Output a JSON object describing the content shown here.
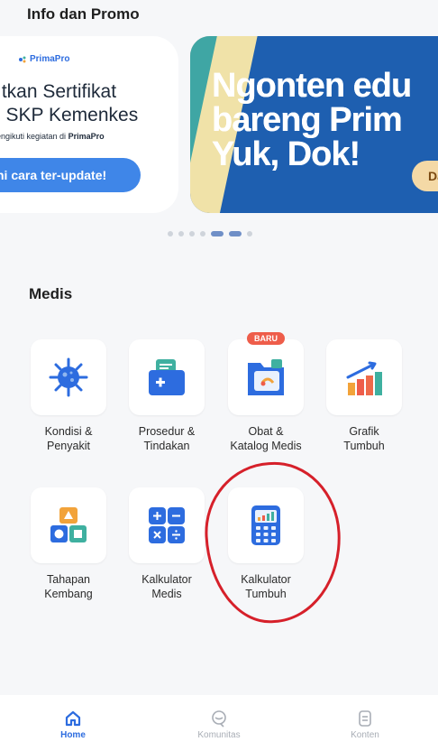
{
  "header": {
    "title": "Info dan Promo"
  },
  "carousel": {
    "card_left": {
      "brand": "PrimaPro",
      "line1": "ıtkan Sertifikat",
      "line2": "i SKP Kemenkes",
      "sub_prefix": "engikuti kegiatan di ",
      "sub_bold": "PrimaPro",
      "cta": "ni cara ter-update!"
    },
    "card_right": {
      "line1": "Ngonten edu",
      "line2": "bareng Prim",
      "line3": "Yuk, Dok!",
      "pill": "Da"
    },
    "dots": 7,
    "active_dots": [
      4,
      5
    ]
  },
  "section": {
    "title": "Medis"
  },
  "tiles": [
    {
      "label": "Kondisi &\nPenyakit",
      "icon": "virus-icon"
    },
    {
      "label": "Prosedur &\nTindakan",
      "icon": "medical-kit-icon"
    },
    {
      "label": "Obat &\nKatalog Medis",
      "icon": "folder-medicine-icon",
      "badge": "BARU"
    },
    {
      "label": "Grafik\nTumbuh",
      "icon": "growth-chart-icon"
    },
    {
      "label": "Tahapan\nKembang",
      "icon": "shapes-blocks-icon"
    },
    {
      "label": "Kalkulator\nMedis",
      "icon": "calculator-grid-icon"
    },
    {
      "label": "Kalkulator\nTumbuh",
      "icon": "growth-calculator-icon"
    }
  ],
  "bottom_nav": [
    {
      "label": "Home",
      "active": true,
      "icon": "home-icon"
    },
    {
      "label": "Komunitas",
      "active": false,
      "icon": "chat-icon"
    },
    {
      "label": "Konten",
      "active": false,
      "icon": "document-icon"
    }
  ],
  "colors": {
    "accent": "#2d6cdf",
    "badge": "#ee5d4a",
    "annotation": "#d6202a"
  }
}
